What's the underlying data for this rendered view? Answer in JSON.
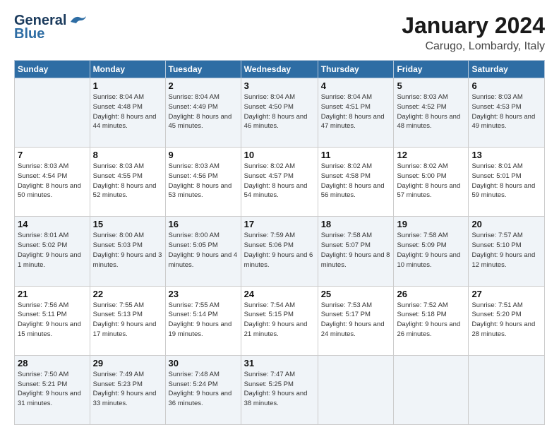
{
  "logo": {
    "line1": "General",
    "line2": "Blue"
  },
  "title": "January 2024",
  "subtitle": "Carugo, Lombardy, Italy",
  "weekdays": [
    "Sunday",
    "Monday",
    "Tuesday",
    "Wednesday",
    "Thursday",
    "Friday",
    "Saturday"
  ],
  "weeks": [
    [
      {
        "day": "",
        "sunrise": "",
        "sunset": "",
        "daylight": ""
      },
      {
        "day": "1",
        "sunrise": "Sunrise: 8:04 AM",
        "sunset": "Sunset: 4:48 PM",
        "daylight": "Daylight: 8 hours and 44 minutes."
      },
      {
        "day": "2",
        "sunrise": "Sunrise: 8:04 AM",
        "sunset": "Sunset: 4:49 PM",
        "daylight": "Daylight: 8 hours and 45 minutes."
      },
      {
        "day": "3",
        "sunrise": "Sunrise: 8:04 AM",
        "sunset": "Sunset: 4:50 PM",
        "daylight": "Daylight: 8 hours and 46 minutes."
      },
      {
        "day": "4",
        "sunrise": "Sunrise: 8:04 AM",
        "sunset": "Sunset: 4:51 PM",
        "daylight": "Daylight: 8 hours and 47 minutes."
      },
      {
        "day": "5",
        "sunrise": "Sunrise: 8:03 AM",
        "sunset": "Sunset: 4:52 PM",
        "daylight": "Daylight: 8 hours and 48 minutes."
      },
      {
        "day": "6",
        "sunrise": "Sunrise: 8:03 AM",
        "sunset": "Sunset: 4:53 PM",
        "daylight": "Daylight: 8 hours and 49 minutes."
      }
    ],
    [
      {
        "day": "7",
        "sunrise": "Sunrise: 8:03 AM",
        "sunset": "Sunset: 4:54 PM",
        "daylight": "Daylight: 8 hours and 50 minutes."
      },
      {
        "day": "8",
        "sunrise": "Sunrise: 8:03 AM",
        "sunset": "Sunset: 4:55 PM",
        "daylight": "Daylight: 8 hours and 52 minutes."
      },
      {
        "day": "9",
        "sunrise": "Sunrise: 8:03 AM",
        "sunset": "Sunset: 4:56 PM",
        "daylight": "Daylight: 8 hours and 53 minutes."
      },
      {
        "day": "10",
        "sunrise": "Sunrise: 8:02 AM",
        "sunset": "Sunset: 4:57 PM",
        "daylight": "Daylight: 8 hours and 54 minutes."
      },
      {
        "day": "11",
        "sunrise": "Sunrise: 8:02 AM",
        "sunset": "Sunset: 4:58 PM",
        "daylight": "Daylight: 8 hours and 56 minutes."
      },
      {
        "day": "12",
        "sunrise": "Sunrise: 8:02 AM",
        "sunset": "Sunset: 5:00 PM",
        "daylight": "Daylight: 8 hours and 57 minutes."
      },
      {
        "day": "13",
        "sunrise": "Sunrise: 8:01 AM",
        "sunset": "Sunset: 5:01 PM",
        "daylight": "Daylight: 8 hours and 59 minutes."
      }
    ],
    [
      {
        "day": "14",
        "sunrise": "Sunrise: 8:01 AM",
        "sunset": "Sunset: 5:02 PM",
        "daylight": "Daylight: 9 hours and 1 minute."
      },
      {
        "day": "15",
        "sunrise": "Sunrise: 8:00 AM",
        "sunset": "Sunset: 5:03 PM",
        "daylight": "Daylight: 9 hours and 3 minutes."
      },
      {
        "day": "16",
        "sunrise": "Sunrise: 8:00 AM",
        "sunset": "Sunset: 5:05 PM",
        "daylight": "Daylight: 9 hours and 4 minutes."
      },
      {
        "day": "17",
        "sunrise": "Sunrise: 7:59 AM",
        "sunset": "Sunset: 5:06 PM",
        "daylight": "Daylight: 9 hours and 6 minutes."
      },
      {
        "day": "18",
        "sunrise": "Sunrise: 7:58 AM",
        "sunset": "Sunset: 5:07 PM",
        "daylight": "Daylight: 9 hours and 8 minutes."
      },
      {
        "day": "19",
        "sunrise": "Sunrise: 7:58 AM",
        "sunset": "Sunset: 5:09 PM",
        "daylight": "Daylight: 9 hours and 10 minutes."
      },
      {
        "day": "20",
        "sunrise": "Sunrise: 7:57 AM",
        "sunset": "Sunset: 5:10 PM",
        "daylight": "Daylight: 9 hours and 12 minutes."
      }
    ],
    [
      {
        "day": "21",
        "sunrise": "Sunrise: 7:56 AM",
        "sunset": "Sunset: 5:11 PM",
        "daylight": "Daylight: 9 hours and 15 minutes."
      },
      {
        "day": "22",
        "sunrise": "Sunrise: 7:55 AM",
        "sunset": "Sunset: 5:13 PM",
        "daylight": "Daylight: 9 hours and 17 minutes."
      },
      {
        "day": "23",
        "sunrise": "Sunrise: 7:55 AM",
        "sunset": "Sunset: 5:14 PM",
        "daylight": "Daylight: 9 hours and 19 minutes."
      },
      {
        "day": "24",
        "sunrise": "Sunrise: 7:54 AM",
        "sunset": "Sunset: 5:15 PM",
        "daylight": "Daylight: 9 hours and 21 minutes."
      },
      {
        "day": "25",
        "sunrise": "Sunrise: 7:53 AM",
        "sunset": "Sunset: 5:17 PM",
        "daylight": "Daylight: 9 hours and 24 minutes."
      },
      {
        "day": "26",
        "sunrise": "Sunrise: 7:52 AM",
        "sunset": "Sunset: 5:18 PM",
        "daylight": "Daylight: 9 hours and 26 minutes."
      },
      {
        "day": "27",
        "sunrise": "Sunrise: 7:51 AM",
        "sunset": "Sunset: 5:20 PM",
        "daylight": "Daylight: 9 hours and 28 minutes."
      }
    ],
    [
      {
        "day": "28",
        "sunrise": "Sunrise: 7:50 AM",
        "sunset": "Sunset: 5:21 PM",
        "daylight": "Daylight: 9 hours and 31 minutes."
      },
      {
        "day": "29",
        "sunrise": "Sunrise: 7:49 AM",
        "sunset": "Sunset: 5:23 PM",
        "daylight": "Daylight: 9 hours and 33 minutes."
      },
      {
        "day": "30",
        "sunrise": "Sunrise: 7:48 AM",
        "sunset": "Sunset: 5:24 PM",
        "daylight": "Daylight: 9 hours and 36 minutes."
      },
      {
        "day": "31",
        "sunrise": "Sunrise: 7:47 AM",
        "sunset": "Sunset: 5:25 PM",
        "daylight": "Daylight: 9 hours and 38 minutes."
      },
      {
        "day": "",
        "sunrise": "",
        "sunset": "",
        "daylight": ""
      },
      {
        "day": "",
        "sunrise": "",
        "sunset": "",
        "daylight": ""
      },
      {
        "day": "",
        "sunrise": "",
        "sunset": "",
        "daylight": ""
      }
    ]
  ]
}
